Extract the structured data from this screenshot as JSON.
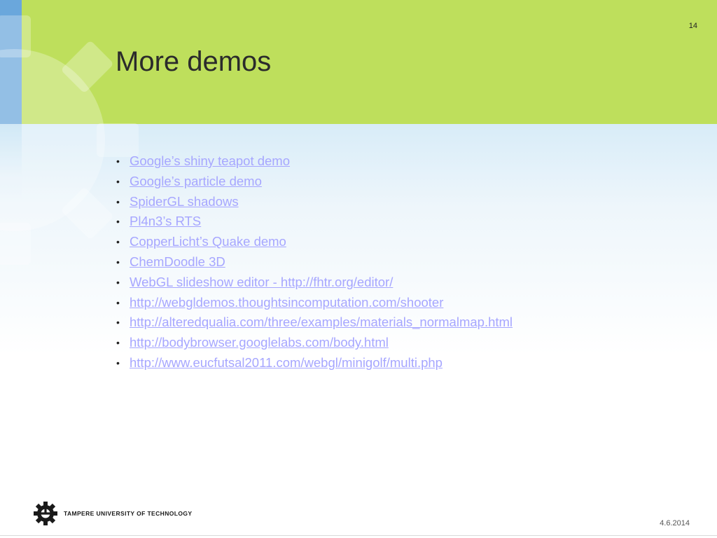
{
  "slide": {
    "page_number": "14",
    "title": "More demos",
    "links": [
      "Google’s shiny teapot demo",
      "Google’s particle demo",
      "SpiderGL shadows",
      "Pl4n3’s RTS",
      "CopperLicht’s Quake demo",
      "ChemDoodle 3D",
      "WebGL slideshow editor - http://fhtr.org/editor/",
      "http://webgldemos.thoughtsincomputation.com/shooter",
      "http://alteredqualia.com/three/examples/materials_normalmap.html",
      "http://bodybrowser.googlelabs.com/body.html",
      "http://www.eucfutsal2011.com/webgl/minigolf/multi.php"
    ],
    "bullet": "•"
  },
  "footer": {
    "logo_text": "TAMPERE UNIVERSITY OF TECHNOLOGY",
    "logo_icon": "tut-gear-logo-icon",
    "date": "4.6.2014"
  },
  "colors": {
    "header_green": "#bedf5c",
    "accent_blue": "#6aa7dc",
    "link": "#a6a6ff",
    "title_text": "#2b2b2b"
  }
}
